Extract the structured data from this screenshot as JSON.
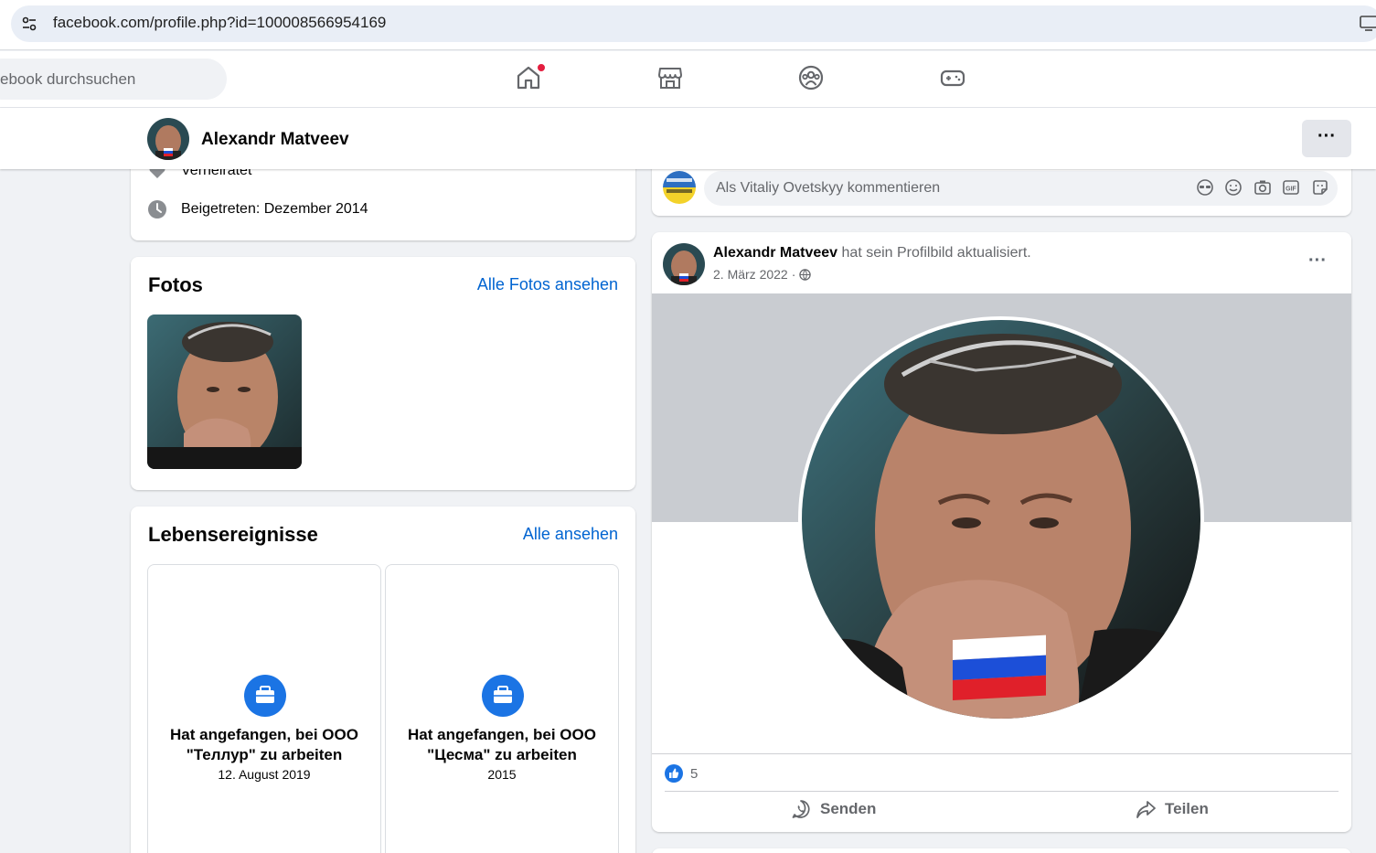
{
  "browser": {
    "url": "facebook.com/profile.php?id=100008566954169"
  },
  "nav": {
    "search_placeholder": "ebook durchsuchen",
    "icons": [
      "home-icon",
      "marketplace-icon",
      "groups-icon",
      "gaming-icon"
    ]
  },
  "profile_bar": {
    "name": "Alexandr Matveev",
    "more_label": "···"
  },
  "intro": {
    "relationship": "Verheiratet",
    "joined": "Beigetreten: Dezember 2014"
  },
  "photos": {
    "title": "Fotos",
    "link": "Alle Fotos ansehen"
  },
  "life_events": {
    "title": "Lebensereignisse",
    "link": "Alle ansehen",
    "items": [
      {
        "title": "Hat angefangen, bei ООО \"Теллур\" zu arbeiten",
        "date": "12. August 2019"
      },
      {
        "title": "Hat angefangen, bei ООО \"Цесма\" zu arbeiten",
        "date": "2015"
      }
    ]
  },
  "comment_box": {
    "placeholder": "Als Vitaliy Ovetskyy kommentieren"
  },
  "post": {
    "author": "Alexandr Matveev",
    "action": "hat sein Profilbild aktualisiert.",
    "date": "2. März 2022",
    "separator": "·",
    "more_label": "···",
    "likes": "5",
    "send_label": "Senden",
    "share_label": "Teilen"
  },
  "colors": {
    "accent": "#1b74e4",
    "link": "#0064d1",
    "background": "#f0f2f5"
  }
}
